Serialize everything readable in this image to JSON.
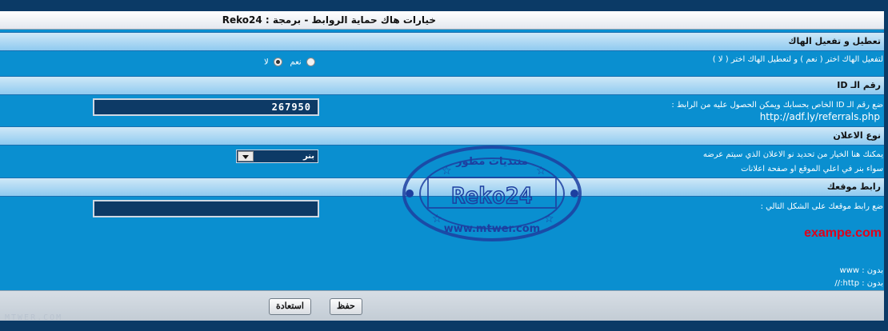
{
  "title": "خيارات هاك حماية الروابط - برمجة : Reko24",
  "sections": [
    {
      "head": "تعطيل و تفعيل الهاك",
      "desc": "لتفعيل الهاك اختر ( نعم ) و لتعطيل الهاك اختر ( لا )"
    },
    {
      "head": "رقم الـ ID",
      "desc": "ضع رقم الـ ID الخاص بحسابك ويمكن الحصول عليه من الرابط :",
      "url": "http://adf.ly/referrals.php"
    },
    {
      "head": "نوع الاعلان",
      "desc_line1": "يمكنك هنا الخيار من تحديد نو الاعلان الذي سيتم عرضه",
      "desc_line2": "سواء بنر في اعلي الموقع او صفحة اعلانات"
    },
    {
      "head": "رابط موقعك",
      "desc": "ضع رابط موقعك على الشكل التالي :",
      "example": "exampe.com",
      "no_www": "بدون : www",
      "no_http": "بدون : http://"
    }
  ],
  "radio": {
    "yes": "نعم",
    "no": "لا"
  },
  "id_value": "267950",
  "select_value": "بنر",
  "site_value": "",
  "buttons": {
    "save": "حفظ",
    "restore": "استعادة"
  },
  "watermark": "MTWER.COM",
  "stamp": {
    "top": "منتديات مطور",
    "center": "Reko24",
    "bottom": "www.mtwer.com"
  },
  "colors": {
    "panel": "#0a8fd0",
    "dark": "#0b3a66",
    "section": "#8fcaf0",
    "accent_red": "#e0001a"
  }
}
